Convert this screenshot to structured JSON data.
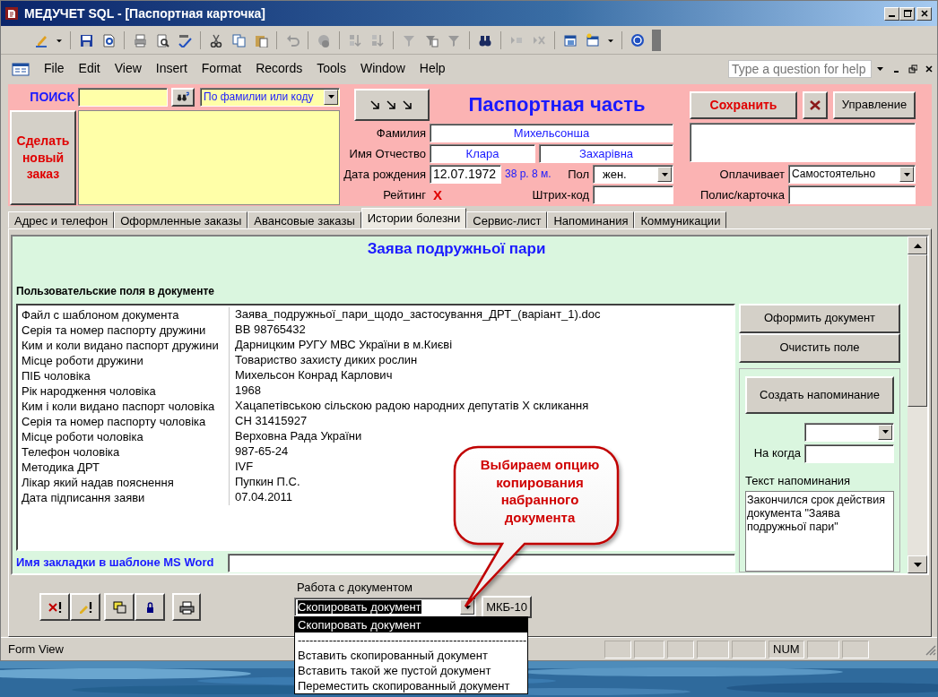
{
  "window": {
    "title": "МЕДУЧЕТ SQL - [Паспортная карточка]"
  },
  "menu": [
    "File",
    "Edit",
    "View",
    "Insert",
    "Format",
    "Records",
    "Tools",
    "Window",
    "Help"
  ],
  "help_box": {
    "placeholder": "Type a question for help"
  },
  "search": {
    "label": "ПОИСК",
    "mode": "По фамилии или коду"
  },
  "new_order_button": "Сделать новый заказ",
  "header": {
    "title": "Паспортная часть",
    "surname": {
      "label": "Фамилия",
      "value": "Михельсонша"
    },
    "name": {
      "label": "Имя Отчество",
      "first": "Клара",
      "patronymic": "Захарівна"
    },
    "birth": {
      "label": "Дата рождения",
      "value": "12.07.1972",
      "age": "38 р. 8 м."
    },
    "sex": {
      "label": "Пол",
      "value": "жен."
    },
    "rating": {
      "label": "Рейтинг",
      "value": "X"
    },
    "barcode": {
      "label": "Штрих-код"
    },
    "save_button": "Сохранить",
    "manage_button": "Управление",
    "payer": {
      "label": "Оплачивает",
      "value": "Самостоятельно"
    },
    "policy": {
      "label": "Полис/карточка"
    }
  },
  "tabs": [
    {
      "label": "Адрес и телефон",
      "selected": false
    },
    {
      "label": "Оформленные заказы",
      "selected": false
    },
    {
      "label": "Авансовые заказы",
      "selected": false
    },
    {
      "label": "Истории болезни",
      "selected": true
    },
    {
      "label": "Сервис-лист",
      "selected": false
    },
    {
      "label": "Напоминания",
      "selected": false
    },
    {
      "label": "Коммуникации",
      "selected": false
    }
  ],
  "document": {
    "title": "Заява подружньої пари",
    "fields_caption": "Пользовательские поля в документе",
    "rows": [
      {
        "name": "Файл с шаблоном документа",
        "value": "Заява_подружньої_пари_щодо_застосування_ДРТ_(варіант_1).doc"
      },
      {
        "name": "Серія та номер паспорту дружини",
        "value": "ВВ 98765432"
      },
      {
        "name": "Ким и коли видано паспорт дружини",
        "value": "Дарницким РУГУ МВС України в м.Києві"
      },
      {
        "name": "Місце роботи дружини",
        "value": "Товариство захисту диких рослин"
      },
      {
        "name": "ПІБ чоловіка",
        "value": "Михельсон Конрад Карлович"
      },
      {
        "name": "Рік народження чоловіка",
        "value": "1968"
      },
      {
        "name": "Ким і коли видано паспорт чоловіка",
        "value": "Хацапетівською сільскою радою народних депутатів Х скликання"
      },
      {
        "name": "Серія та номер паспорту чоловіка",
        "value": "СН 31415927"
      },
      {
        "name": "Місце роботи чоловіка",
        "value": "Верховна Рада України"
      },
      {
        "name": "Телефон чоловіка",
        "value": "987-65-24"
      },
      {
        "name": "Методика ДРТ",
        "value": "IVF"
      },
      {
        "name": "Лікар який надав пояснення",
        "value": "Пупкин П.С."
      },
      {
        "name": "Дата підписання заяви",
        "value": "07.04.2011"
      }
    ],
    "bookmark_label": "Имя закладки в шаблоне MS Word"
  },
  "actions": [
    "Оформить документ",
    "Очистить поле"
  ],
  "reminder": {
    "button": "Создать напоминание",
    "when_label": "На когда",
    "text_label": "Текст напоминания",
    "text": "Закончился срок действия  документа \"Заява подружньої пари\""
  },
  "document_work": {
    "label": "Работа с документом",
    "value": "Скопировать документ",
    "expanded": true,
    "options": [
      {
        "label": "Скопировать документ",
        "selected": true
      },
      {
        "label": "-----------------------------------------------------------",
        "selected": false
      },
      {
        "label": "Вставить скопированный документ",
        "selected": false
      },
      {
        "label": "Вставить такой же пустой документ",
        "selected": false
      },
      {
        "label": "Переместить скопированный документ",
        "selected": false
      }
    ]
  },
  "mkb_button": "МКБ-10",
  "callout": "Выбираем опцию копирования набранного документа",
  "status_bar": {
    "mode": "Form View",
    "indicator": "NUM"
  }
}
